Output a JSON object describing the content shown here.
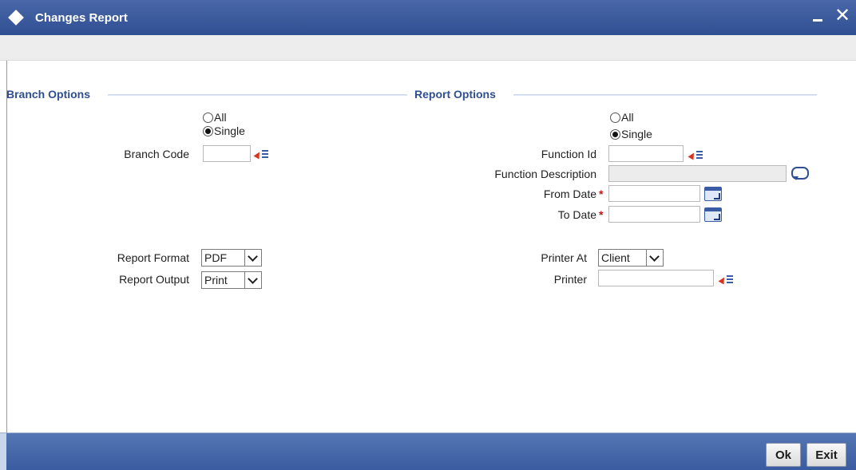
{
  "window": {
    "title": "Changes Report",
    "minimize_icon": "minimize-icon",
    "close_glyph": "✕"
  },
  "branch_options": {
    "section_title": "Branch Options",
    "radio_all": "All",
    "radio_single": "Single",
    "selected": "Single",
    "branch_code_label": "Branch Code",
    "branch_code_value": ""
  },
  "report_options": {
    "section_title": "Report Options",
    "radio_all": "All",
    "radio_single": "Single",
    "selected": "Single",
    "function_id_label": "Function Id",
    "function_id_value": "",
    "function_description_label": "Function Description",
    "function_description_value": "",
    "from_date_label": "From Date",
    "from_date_value": "",
    "to_date_label": "To Date",
    "to_date_value": "",
    "required_mark": "*"
  },
  "output": {
    "report_format_label": "Report Format",
    "report_format_value": "PDF",
    "report_output_label": "Report Output",
    "report_output_value": "Print",
    "printer_at_label": "Printer At",
    "printer_at_value": "Client",
    "printer_label": "Printer",
    "printer_value": ""
  },
  "footer": {
    "ok_label": "Ok",
    "exit_label": "Exit"
  },
  "colors": {
    "title_bar": "#3b5ba5",
    "section_title": "#2f4f93",
    "required": "#d01010",
    "footer_bar": "#4a6aaa"
  }
}
